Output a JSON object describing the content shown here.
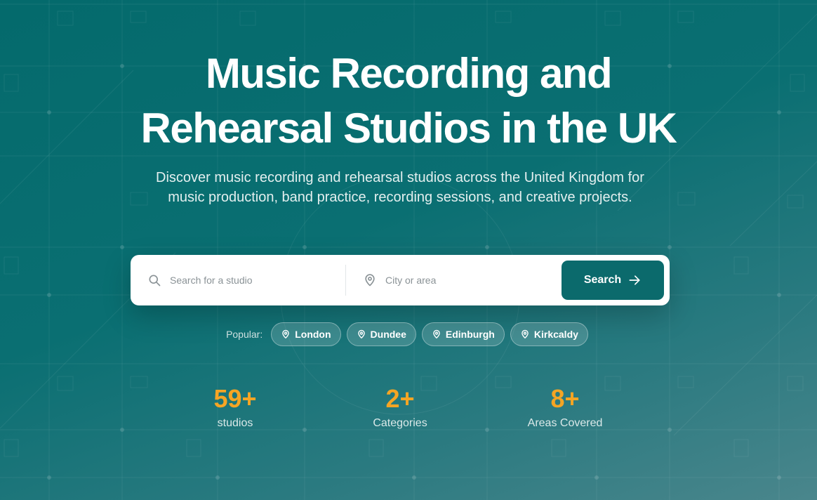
{
  "hero": {
    "title_line1": "Music Recording and",
    "title_line2": "Rehearsal Studios in the UK",
    "subtitle": "Discover music recording and rehearsal studios across the United Kingdom for music production, band practice, recording sessions, and creative projects."
  },
  "search": {
    "query_placeholder": "Search for a studio",
    "query_value": "",
    "location_placeholder": "City or area",
    "location_value": "",
    "button_label": "Search"
  },
  "popular": {
    "label": "Popular:",
    "cities": [
      "London",
      "Dundee",
      "Edinburgh",
      "Kirkcaldy"
    ]
  },
  "stats": [
    {
      "value": "59+",
      "label": "studios"
    },
    {
      "value": "2+",
      "label": "Categories"
    },
    {
      "value": "8+",
      "label": "Areas Covered"
    }
  ],
  "icons": {
    "search": "search-icon",
    "location": "map-pin-icon",
    "arrow": "arrow-right-icon"
  },
  "colors": {
    "primary": "#0b6a6c",
    "accent": "#f5a524",
    "background_start": "#046a6c",
    "background_end": "#4a868c"
  }
}
